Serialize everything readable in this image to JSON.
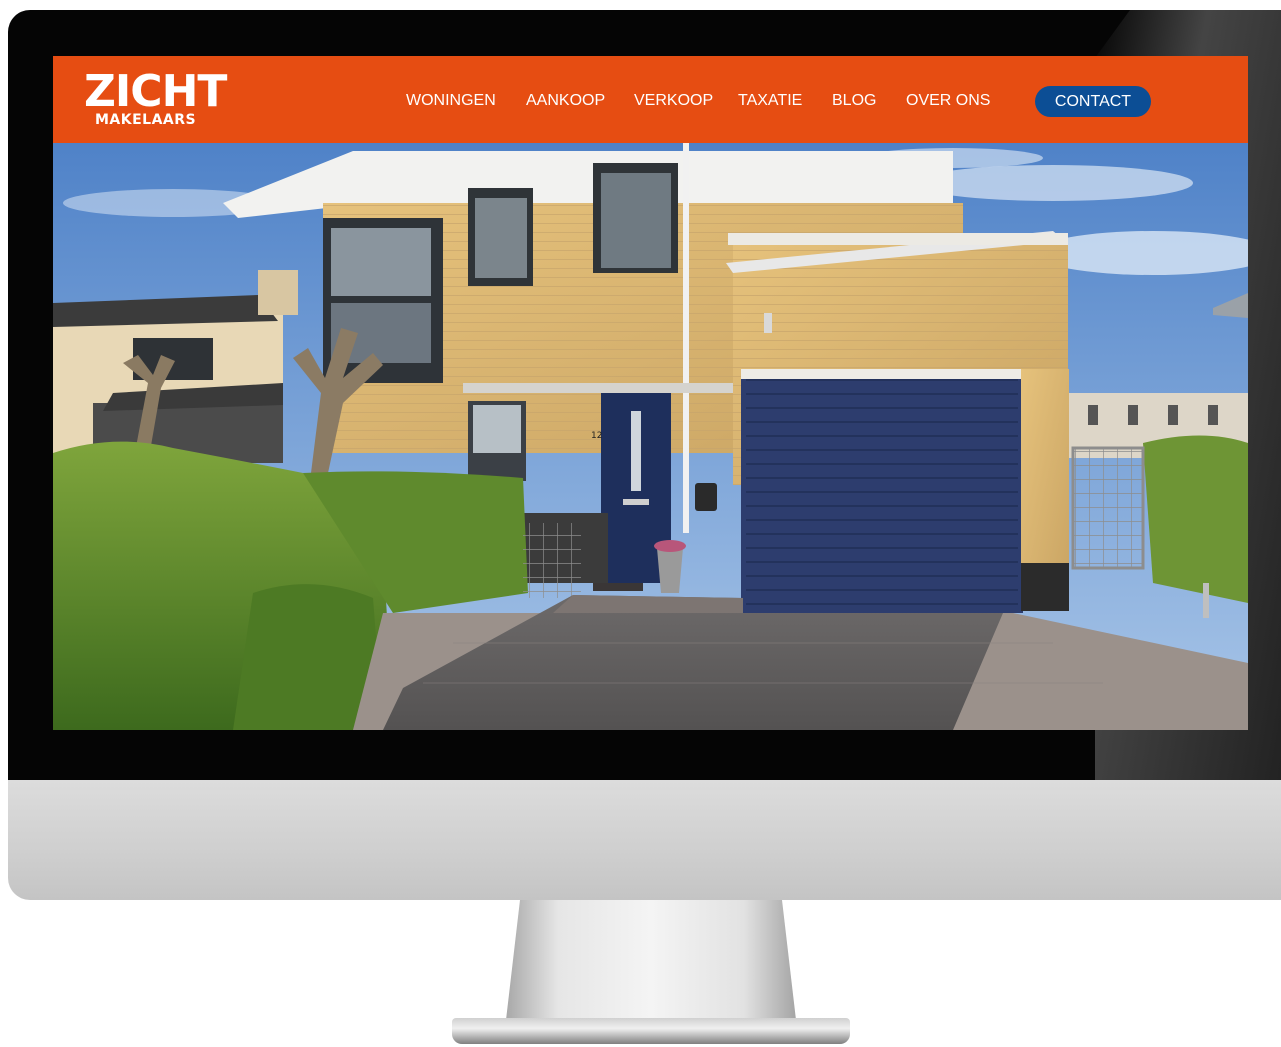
{
  "logo": {
    "name": "ZICHT",
    "tagline": "MAKELAARS"
  },
  "nav": {
    "items": [
      {
        "label": "WONINGEN"
      },
      {
        "label": "AANKOOP"
      },
      {
        "label": "VERKOOP"
      },
      {
        "label": "TAXATIE"
      },
      {
        "label": "BLOG"
      },
      {
        "label": "OVER ONS"
      }
    ],
    "contact_label": "CONTACT"
  },
  "hero": {
    "house_number": "12"
  },
  "colors": {
    "brand_orange": "#e64d12",
    "contact_blue": "#0c4e95"
  }
}
